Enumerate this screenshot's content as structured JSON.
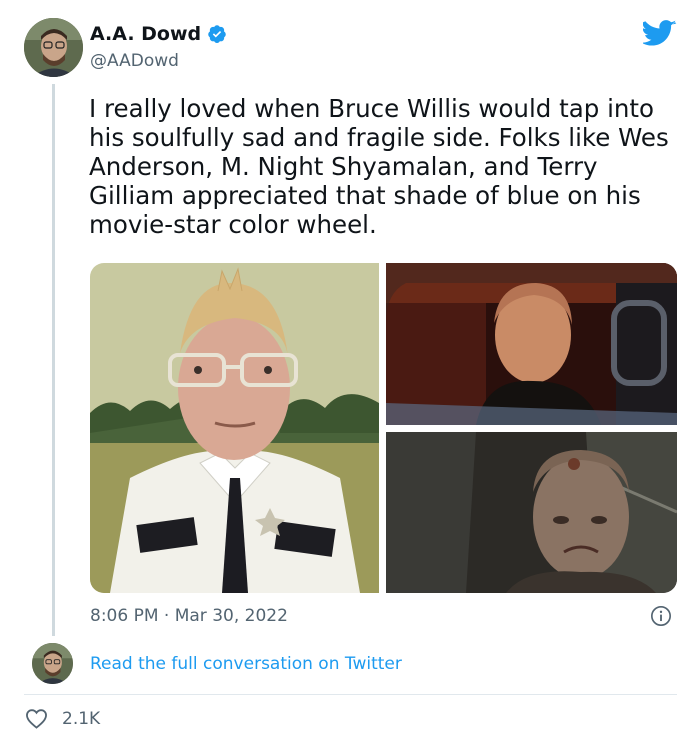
{
  "tweet": {
    "author": {
      "name": "A.A. Dowd",
      "handle": "@AADowd",
      "verified": true
    },
    "text": "I really loved when Bruce Willis would tap into his soulfully sad and fragile side. Folks like Wes Anderson, M. Night Shyamalan, and Terry Gilliam appreciated that shade of blue on his movie-star color wheel.",
    "timestamp": "8:06 PM · Mar 30, 2022",
    "read_link": "Read the full conversation on Twitter",
    "like_count": "2.1K",
    "media_count": 3
  },
  "colors": {
    "text_primary": "#0f1419",
    "text_secondary": "#536471",
    "link": "#1d9bf0",
    "twitter_blue": "#1d9bf0",
    "verified_blue": "#1d9bf0",
    "thread_line": "#cfd9de",
    "divider": "#e1e8ed"
  },
  "icons": [
    "verified-badge-icon",
    "twitter-bird-icon",
    "info-icon",
    "heart-icon"
  ]
}
